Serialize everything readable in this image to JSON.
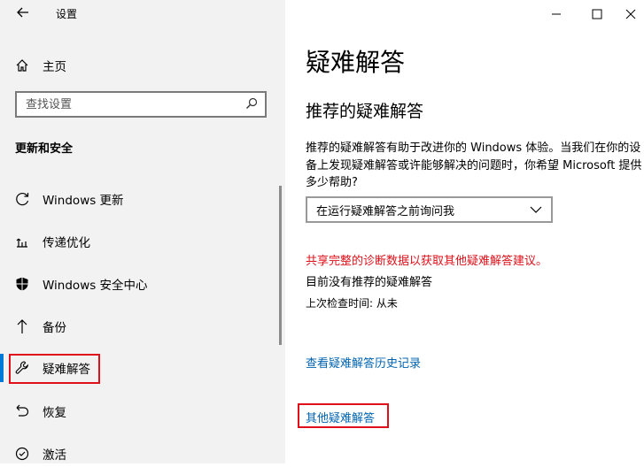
{
  "window": {
    "title": "设置"
  },
  "sidebar": {
    "home_label": "主页",
    "search_placeholder": "查找设置",
    "section_title": "更新和安全",
    "items": [
      {
        "label": "Windows 更新",
        "icon": "refresh-icon"
      },
      {
        "label": "传递优化",
        "icon": "delivery-optimization-icon"
      },
      {
        "label": "Windows 安全中心",
        "icon": "shield-icon"
      },
      {
        "label": "备份",
        "icon": "backup-arrow-icon"
      },
      {
        "label": "疑难解答",
        "icon": "wrench-icon",
        "selected": true
      },
      {
        "label": "恢复",
        "icon": "recovery-icon"
      },
      {
        "label": "激活",
        "icon": "activation-icon"
      }
    ]
  },
  "main": {
    "title": "疑难解答",
    "subtitle": "推荐的疑难解答",
    "description": "推荐的疑难解答有助于改进你的 Windows 体验。当我们在你的设备上发现疑难解答或许能够解决的问题时，你希望 Microsoft 提供多少帮助?",
    "dropdown_value": "在运行疑难解答之前询问我",
    "diagnostic_notice": "共享完整的诊断数据以获取其他疑难解答建议。",
    "no_recommended": "目前没有推荐的疑难解答",
    "last_checked": "上次检查时间: 从未",
    "history_link": "查看疑难解答历史记录",
    "other_link": "其他疑难解答"
  },
  "colors": {
    "accent": "#0078d7",
    "link": "#0063b1",
    "highlight_red": "#e0101a",
    "sidebar_bg": "#f2f2f2"
  }
}
